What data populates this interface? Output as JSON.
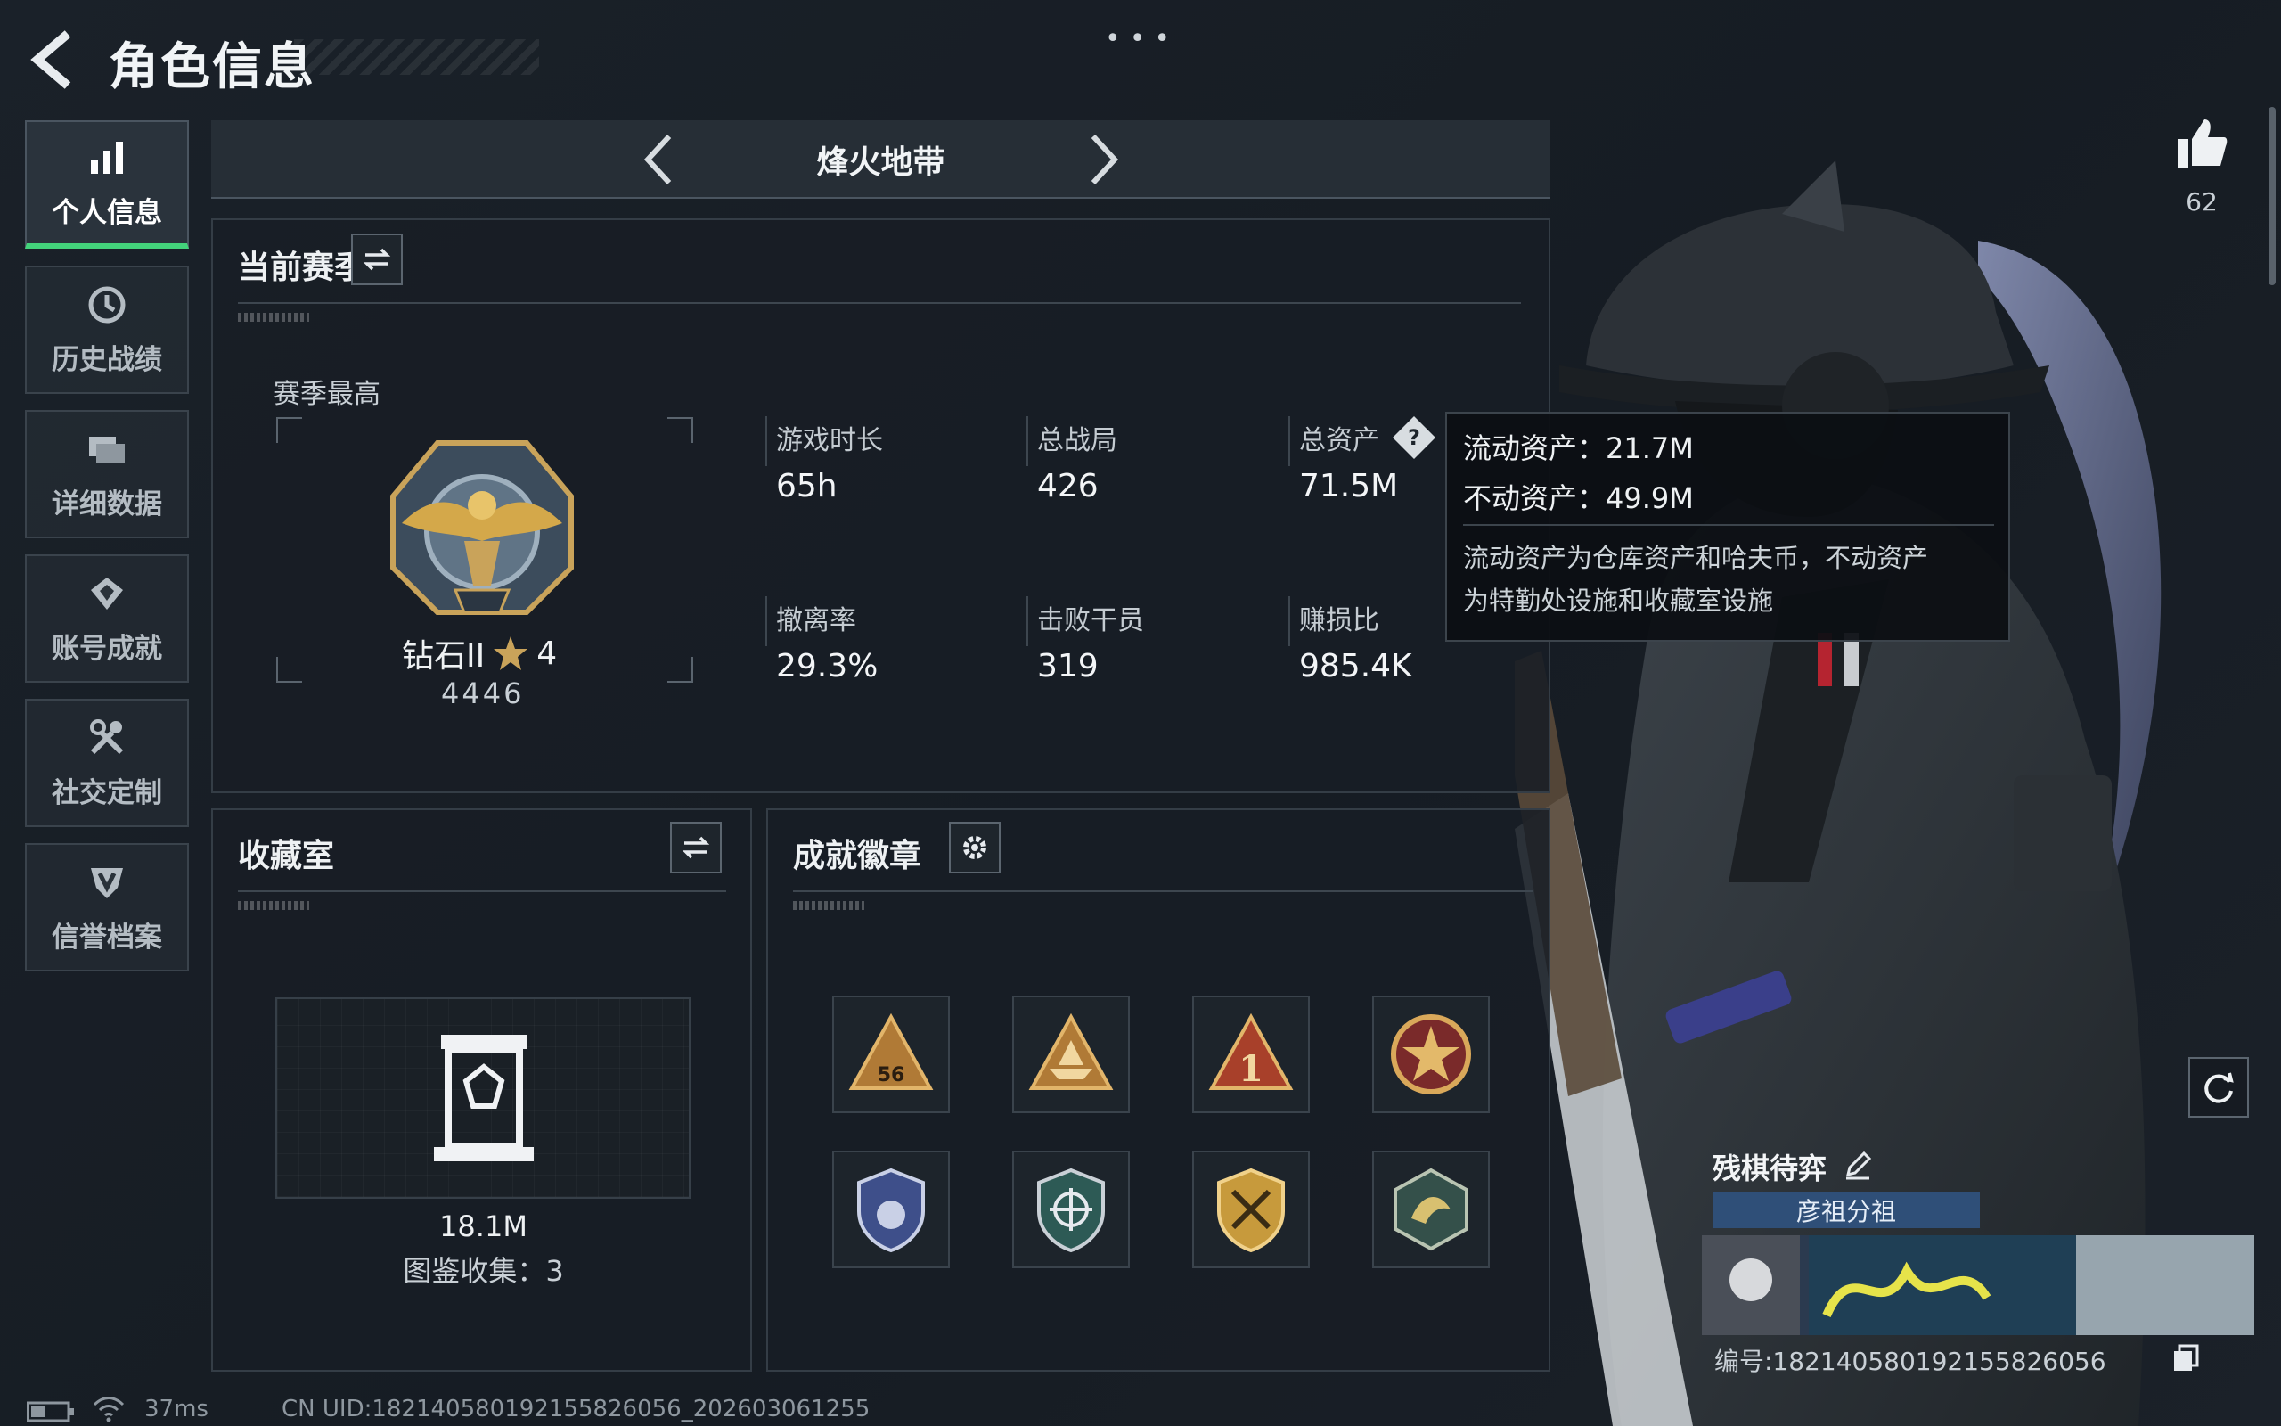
{
  "header": {
    "title": "角色信息",
    "more_label": "•••"
  },
  "sidebar": {
    "items": [
      {
        "label": "个人信息",
        "icon": "bar-chart-icon",
        "active": true
      },
      {
        "label": "历史战绩",
        "icon": "history-clock-icon",
        "active": false
      },
      {
        "label": "详细数据",
        "icon": "folder-icon",
        "active": false
      },
      {
        "label": "账号成就",
        "icon": "achievement-icon",
        "active": false
      },
      {
        "label": "社交定制",
        "icon": "tools-icon",
        "active": false
      },
      {
        "label": "信誉档案",
        "icon": "credit-shield-icon",
        "active": false
      }
    ]
  },
  "mode": {
    "title": "烽火地带"
  },
  "season": {
    "title": "当前赛季",
    "best_label": "赛季最高",
    "rank_name": "钻石II",
    "rank_stars": "4",
    "rank_points": "4446",
    "stats": [
      {
        "label": "游戏时长",
        "value": "65h"
      },
      {
        "label": "总战局",
        "value": "426"
      },
      {
        "label": "总资产",
        "value": "71.5M"
      },
      {
        "label": "撤离率",
        "value": "29.3%"
      },
      {
        "label": "击败干员",
        "value": "319"
      },
      {
        "label": "赚损比",
        "value": "985.4K"
      }
    ]
  },
  "tooltip": {
    "liquid": "流动资产：21.7M",
    "fixed": "不动资产：49.9M",
    "desc_line1": "流动资产为仓库资产和哈夫币，不动资产",
    "desc_line2": "为特勤处设施和收藏室设施"
  },
  "collection": {
    "title": "收藏室",
    "value": "18.1M",
    "count_label": "图鉴收集：3"
  },
  "badges": {
    "title": "成就徽章",
    "items": [
      {
        "name": "badge-56",
        "label": "56"
      },
      {
        "name": "badge-boat",
        "label": ""
      },
      {
        "name": "badge-one",
        "label": "1"
      },
      {
        "name": "badge-star-wreath",
        "label": ""
      },
      {
        "name": "badge-shield-stars",
        "label": ""
      },
      {
        "name": "badge-crosshair",
        "label": ""
      },
      {
        "name": "badge-gold-emblem",
        "label": ""
      },
      {
        "name": "badge-dragon",
        "label": ""
      }
    ]
  },
  "likes": {
    "count": "62"
  },
  "profile": {
    "name": "残棋待弈",
    "group": "彦祖分祖",
    "id_line": "编号:1821405801921558260​56"
  },
  "footer": {
    "ping": "37ms",
    "uid": "CN UID:1821405801921558260​56_202603061255"
  },
  "colors": {
    "accent_green": "#43d37b",
    "group_tag_blue": "#2f4f78"
  }
}
